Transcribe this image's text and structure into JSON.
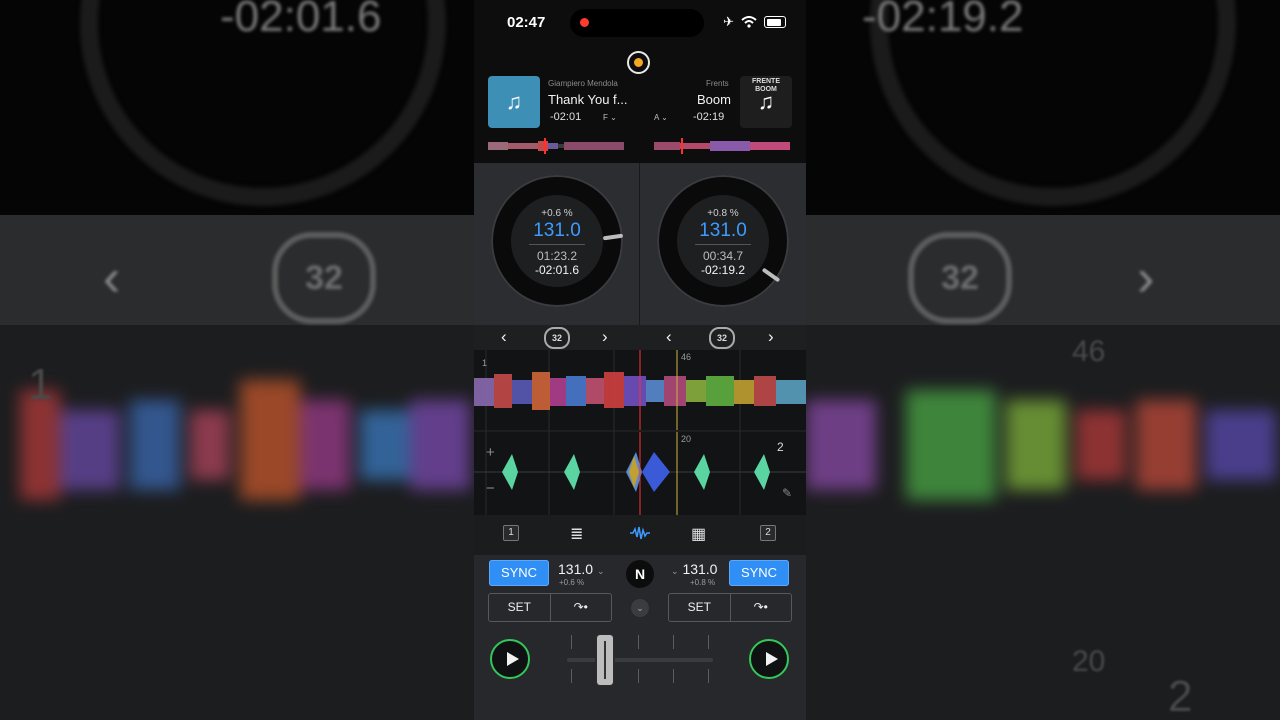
{
  "status_bar": {
    "time": "02:47"
  },
  "background": {
    "left_time": "-02:01.6",
    "right_time": "-02:19.2",
    "left_loop": "32",
    "right_loop": "32",
    "beat_46": "46",
    "beat_20": "20",
    "beat_1": "1",
    "beat_2": "2"
  },
  "deck_left": {
    "artist": "Giampiero Mendola",
    "title": "Thank You f...",
    "remaining": "-02:01",
    "key": "F",
    "pitch": "+0.6 %",
    "bpm": "131.0",
    "elapsed": "01:23.2",
    "remaining_precise": "-02:01.6",
    "loop_size": "32",
    "number": "1"
  },
  "deck_right": {
    "artist": "Frents",
    "title": "Boom",
    "remaining": "-02:19",
    "key": "A",
    "pitch": "+0.8 %",
    "bpm": "131.0",
    "elapsed": "00:34.7",
    "remaining_precise": "-02:19.2",
    "loop_size": "32",
    "number": "2",
    "art_text": "FRENTE BOOM"
  },
  "waveform": {
    "top_beat": "46",
    "top_left_beat": "1",
    "bottom_beat": "20",
    "bottom_right_beat": "2"
  },
  "controls": {
    "sync_label": "SYNC",
    "set_label": "SET",
    "center_logo": "N",
    "left_bpm": "131.0",
    "left_pitch": "+0.6 %",
    "right_bpm": "131.0",
    "right_pitch": "+0.8 %",
    "crossfader_position": 0.26
  },
  "colors": {
    "accent_blue": "#2f8ff5",
    "play_green": "#34c759",
    "bpm_blue": "#3d9bff",
    "record": "#f5a623"
  },
  "icons": [
    "airplane-icon",
    "wifi-icon",
    "battery-icon",
    "music-note-icon",
    "chevron-left-icon",
    "chevron-right-icon",
    "loop-icon",
    "mixer-icon",
    "waveform-icon",
    "grid-icon",
    "play-icon",
    "cue-arrow-icon",
    "pencil-icon",
    "plus-icon",
    "minus-icon"
  ]
}
